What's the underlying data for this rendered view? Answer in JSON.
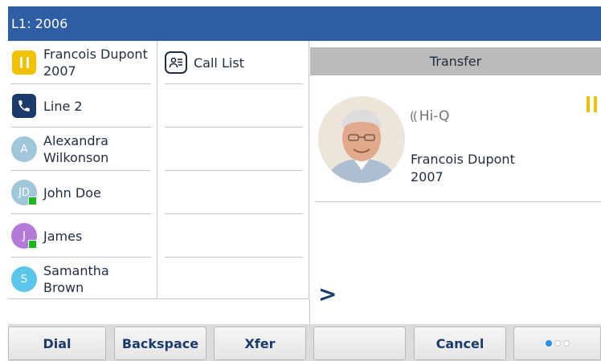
{
  "header": {
    "line_label": "L1: 2006"
  },
  "lines": [
    {
      "icon": "hold-icon",
      "name": "Francois Dupont",
      "sub": "2007",
      "color": "#f2c200"
    },
    {
      "icon": "phone-icon",
      "name": "Line 2",
      "sub": "",
      "color": "#1b3b6b"
    },
    {
      "icon": "avatar",
      "initials": "A",
      "name": "Alexandra",
      "sub": "Wilkonson",
      "color": "#9fc6d9"
    },
    {
      "icon": "avatar",
      "initials": "JD",
      "name": "John Doe",
      "sub": "",
      "color": "#9fc6d9",
      "presence": true
    },
    {
      "icon": "avatar",
      "initials": "J",
      "name": "James",
      "sub": "",
      "color": "#b37ad8",
      "presence": true
    },
    {
      "icon": "avatar",
      "initials": "S",
      "name": "Samantha",
      "sub": "Brown",
      "color": "#5bc5ea"
    }
  ],
  "middle": {
    "call_list_label": "Call List"
  },
  "call": {
    "title": "Transfer",
    "hd_label": "Hi-Q",
    "caller_name": "Francois Dupont",
    "caller_number": "2007",
    "prompt": ">"
  },
  "softkeys": [
    {
      "label": "Dial"
    },
    {
      "label": "Backspace"
    },
    {
      "label": "Xfer"
    },
    {
      "label": ""
    },
    {
      "label": "Cancel"
    },
    {
      "label": ""
    }
  ],
  "colors": {
    "header_bg": "#2f5ea4",
    "hold": "#f2c200",
    "presence_available": "#19b71a",
    "softkey_text": "#1b3b6b",
    "page_dot_active": "#2d8fe0",
    "page_dot_inactive": "#c8c8c8"
  },
  "pagination": {
    "total": 3,
    "active": 1
  }
}
